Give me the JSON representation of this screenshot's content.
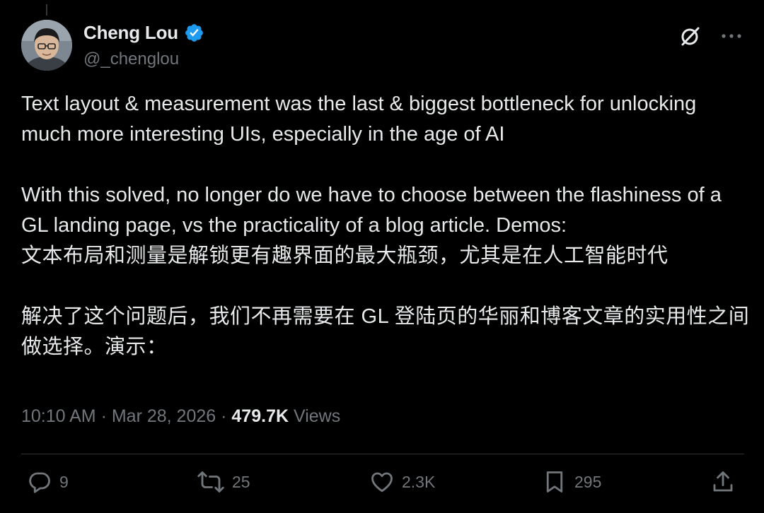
{
  "author": {
    "display_name": "Cheng Lou",
    "handle": "@_chenglou",
    "verified": true,
    "avatar_icon": "user-avatar-photo"
  },
  "header_icons": {
    "grok": "grok-icon",
    "more": "more-options-icon"
  },
  "post": {
    "paragraphs_en": [
      "Text layout & measurement was the last & biggest bottleneck for unlocking much more interesting UIs, especially in the age of AI",
      "With this solved, no longer do we have to choose between the flashiness of a GL landing page, vs the practicality of a blog article. Demos:"
    ],
    "paragraphs_zh": [
      "文本布局和测量是解锁更有趣界面的最大瓶颈，尤其是在人工智能时代",
      "解决了这个问题后，我们不再需要在 GL 登陆页的华丽和博客文章的实用性之间做选择。演示："
    ]
  },
  "meta": {
    "time": "10:10 AM",
    "separator": " · ",
    "date": "Mar 28, 2026",
    "views_count": "479.7K",
    "views_label": " Views"
  },
  "actions": {
    "replies": "9",
    "reposts": "25",
    "likes": "2.3K",
    "bookmarks": "295"
  },
  "colors": {
    "background": "#000000",
    "text_primary": "#e7e9ea",
    "text_secondary": "#71767b",
    "divider": "#2f3336",
    "verified_badge": "#1d9bf0"
  }
}
